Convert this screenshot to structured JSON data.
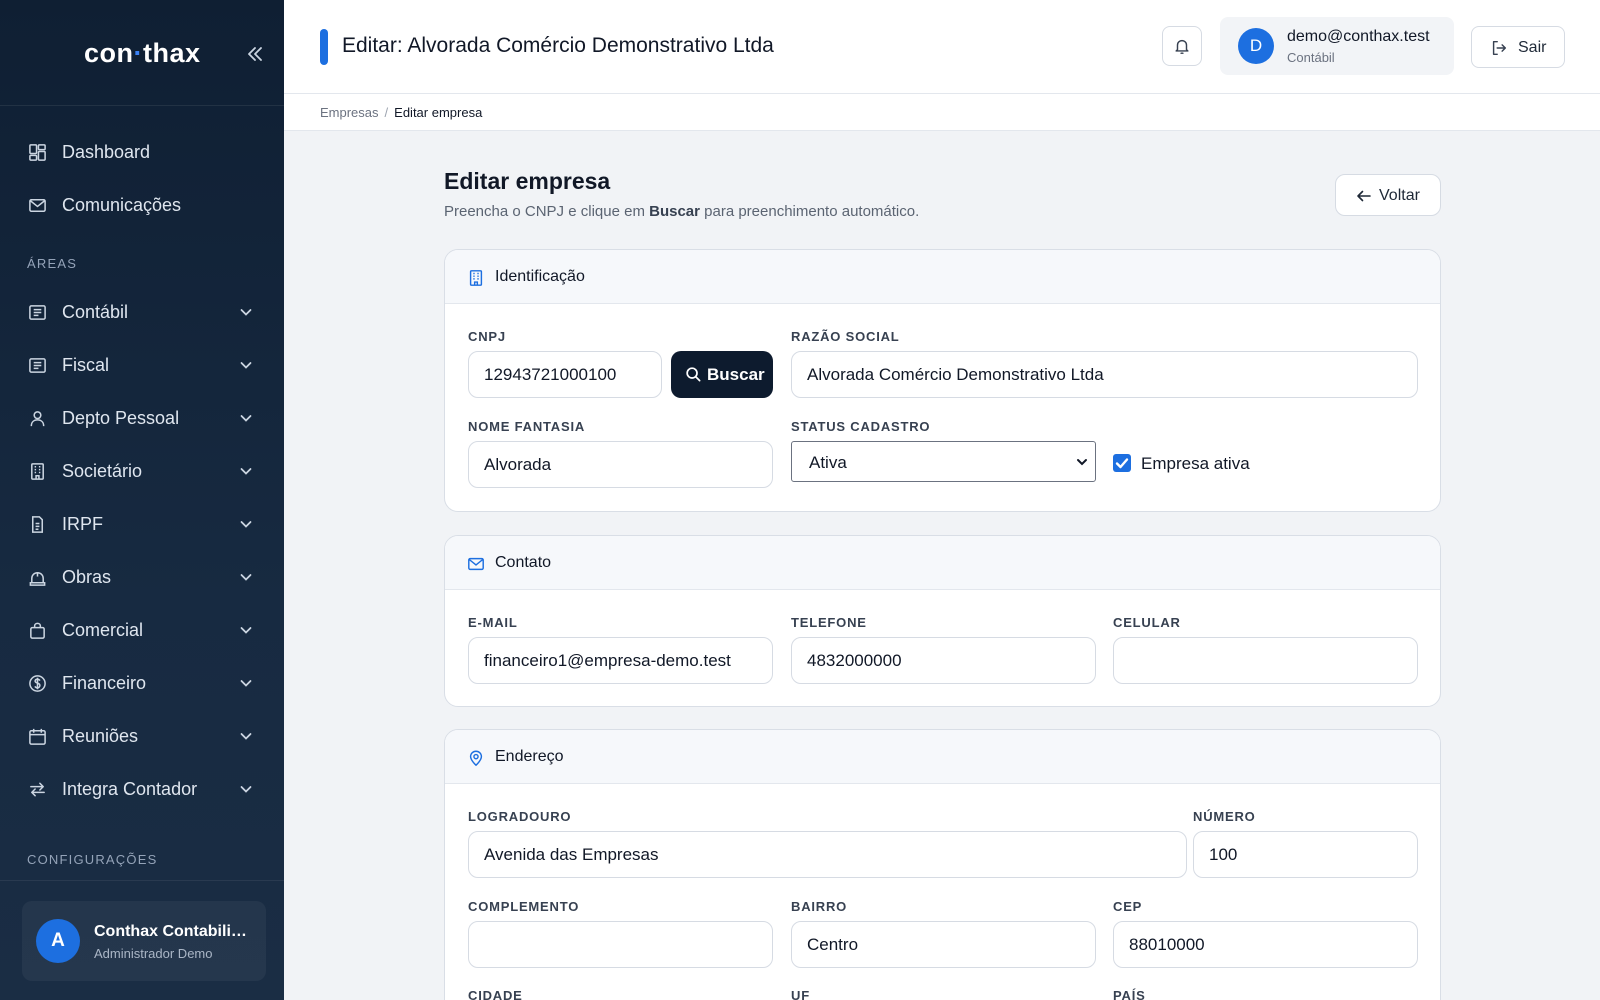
{
  "sidebar": {
    "logo_left": "con",
    "logo_dot": "·",
    "logo_right": "thax",
    "top_items": [
      {
        "label": "Dashboard",
        "icon": "dashboard-icon"
      },
      {
        "label": "Comunicações",
        "icon": "mail-icon"
      }
    ],
    "areas_label": "ÁREAS",
    "areas": [
      {
        "label": "Contábil",
        "icon": "ledger-icon"
      },
      {
        "label": "Fiscal",
        "icon": "ledger-icon"
      },
      {
        "label": "Depto Pessoal",
        "icon": "user-icon"
      },
      {
        "label": "Societário",
        "icon": "building-icon"
      },
      {
        "label": "IRPF",
        "icon": "file-icon"
      },
      {
        "label": "Obras",
        "icon": "helmet-icon"
      },
      {
        "label": "Comercial",
        "icon": "bag-icon"
      },
      {
        "label": "Financeiro",
        "icon": "dollar-icon"
      },
      {
        "label": "Reuniões",
        "icon": "calendar-icon"
      },
      {
        "label": "Integra Contador",
        "icon": "swap-icon"
      }
    ],
    "config_label": "CONFIGURAÇÕES",
    "user": {
      "initial": "A",
      "name": "Conthax Contabilidade",
      "role": "Administrador Demo"
    }
  },
  "header": {
    "title": "Editar: Alvorada Comércio Demonstrativo Ltda",
    "account_initial": "D",
    "account_email": "demo@conthax.test",
    "account_role": "Contábil",
    "logout_label": "Sair"
  },
  "breadcrumb": {
    "parent": "Empresas",
    "separator": "/",
    "current": "Editar empresa"
  },
  "page": {
    "title": "Editar empresa",
    "subtitle_pre": "Preencha o CNPJ e clique em ",
    "subtitle_bold": "Buscar",
    "subtitle_post": " para preenchimento automático.",
    "back_label": "Voltar"
  },
  "identificacao": {
    "title": "Identificação",
    "cnpj_label": "CNPJ",
    "cnpj_value": "12943721000100",
    "buscar_label": "Buscar",
    "razao_label": "RAZÃO SOCIAL",
    "razao_value": "Alvorada Comércio Demonstrativo Ltda",
    "fantasia_label": "NOME FANTASIA",
    "fantasia_value": "Alvorada",
    "status_label": "STATUS CADASTRO",
    "status_value": "Ativa",
    "ativa_label": "Empresa ativa",
    "ativa_checked": true
  },
  "contato": {
    "title": "Contato",
    "email_label": "E-MAIL",
    "email_value": "financeiro1@empresa-demo.test",
    "telefone_label": "TELEFONE",
    "telefone_value": "4832000000",
    "celular_label": "CELULAR",
    "celular_value": ""
  },
  "endereco": {
    "title": "Endereço",
    "logradouro_label": "LOGRADOURO",
    "logradouro_value": "Avenida das Empresas",
    "numero_label": "NÚMERO",
    "numero_value": "100",
    "complemento_label": "COMPLEMENTO",
    "complemento_value": "",
    "bairro_label": "BAIRRO",
    "bairro_value": "Centro",
    "cep_label": "CEP",
    "cep_value": "88010000",
    "cidade_label": "CIDADE",
    "uf_label": "UF",
    "pais_label": "PAÍS"
  },
  "colors": {
    "accent": "#1d6fe0",
    "sidebar": "#0f1f33",
    "dark_button": "#0d1b2e"
  }
}
